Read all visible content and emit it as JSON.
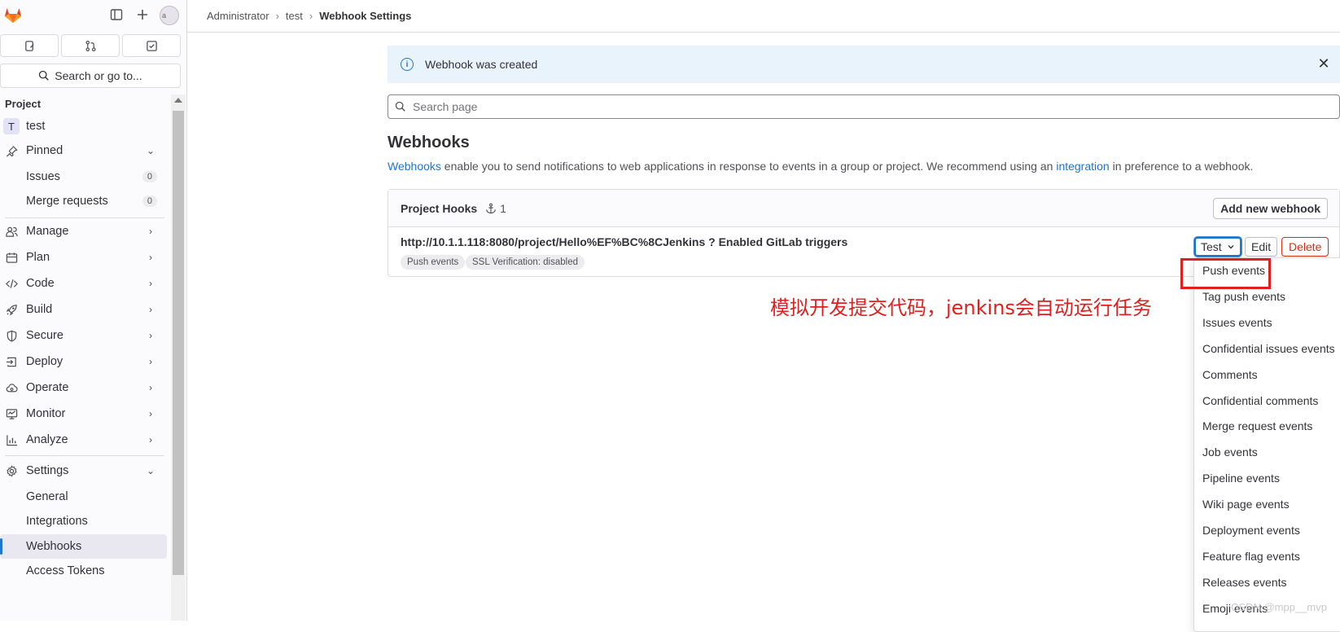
{
  "sidebar": {
    "avatar_alt": "a",
    "search_label": "Search or go to...",
    "section_title": "Project",
    "project": {
      "initial": "T",
      "name": "test"
    },
    "pinned": {
      "label": "Pinned",
      "items": [
        {
          "label": "Issues",
          "count": "0"
        },
        {
          "label": "Merge requests",
          "count": "0"
        }
      ]
    },
    "groups": [
      {
        "label": "Manage",
        "icon": "users-icon"
      },
      {
        "label": "Plan",
        "icon": "calendar-icon"
      },
      {
        "label": "Code",
        "icon": "code-icon"
      },
      {
        "label": "Build",
        "icon": "rocket-icon"
      },
      {
        "label": "Secure",
        "icon": "shield-icon"
      },
      {
        "label": "Deploy",
        "icon": "deploy-icon"
      },
      {
        "label": "Operate",
        "icon": "cloud-icon"
      },
      {
        "label": "Monitor",
        "icon": "monitor-icon"
      },
      {
        "label": "Analyze",
        "icon": "chart-icon"
      }
    ],
    "settings": {
      "label": "Settings",
      "items": [
        {
          "label": "General"
        },
        {
          "label": "Integrations"
        },
        {
          "label": "Webhooks",
          "active": true
        },
        {
          "label": "Access Tokens"
        }
      ]
    }
  },
  "breadcrumb": [
    "Administrator",
    "test",
    "Webhook Settings"
  ],
  "alert": {
    "message": "Webhook was created"
  },
  "search": {
    "placeholder": "Search page"
  },
  "webhooks": {
    "title": "Webhooks",
    "desc_link1": "Webhooks",
    "desc_mid": " enable you to send notifications to web applications in response to events in a group or project. We recommend using an ",
    "desc_link2": "integration",
    "desc_end": " in preference to a webhook.",
    "card_title": "Project Hooks",
    "hook_count": "1",
    "add_label": "Add new webhook",
    "hook": {
      "url": "http://10.1.1.118:8080/project/Hello%EF%BC%8CJenkins ? Enabled GitLab triggers",
      "tags": [
        "Push events",
        "SSL Verification: disabled"
      ]
    },
    "test_label": "Test",
    "edit_label": "Edit",
    "delete_label": "Delete"
  },
  "test_menu": [
    "Push events",
    "Tag push events",
    "Issues events",
    "Confidential issues events",
    "Comments",
    "Confidential comments",
    "Merge request events",
    "Job events",
    "Pipeline events",
    "Wiki page events",
    "Deployment events",
    "Feature flag events",
    "Releases events",
    "Emoji events"
  ],
  "annotation": "模拟开发提交代码，jenkins会自动运行任务",
  "watermark": "CSDN @mpp__mvp",
  "colors": {
    "accent": "#1f75cb",
    "danger": "#dd2b0e",
    "annotation": "#e02020",
    "alert_bg": "#e9f3fc"
  }
}
